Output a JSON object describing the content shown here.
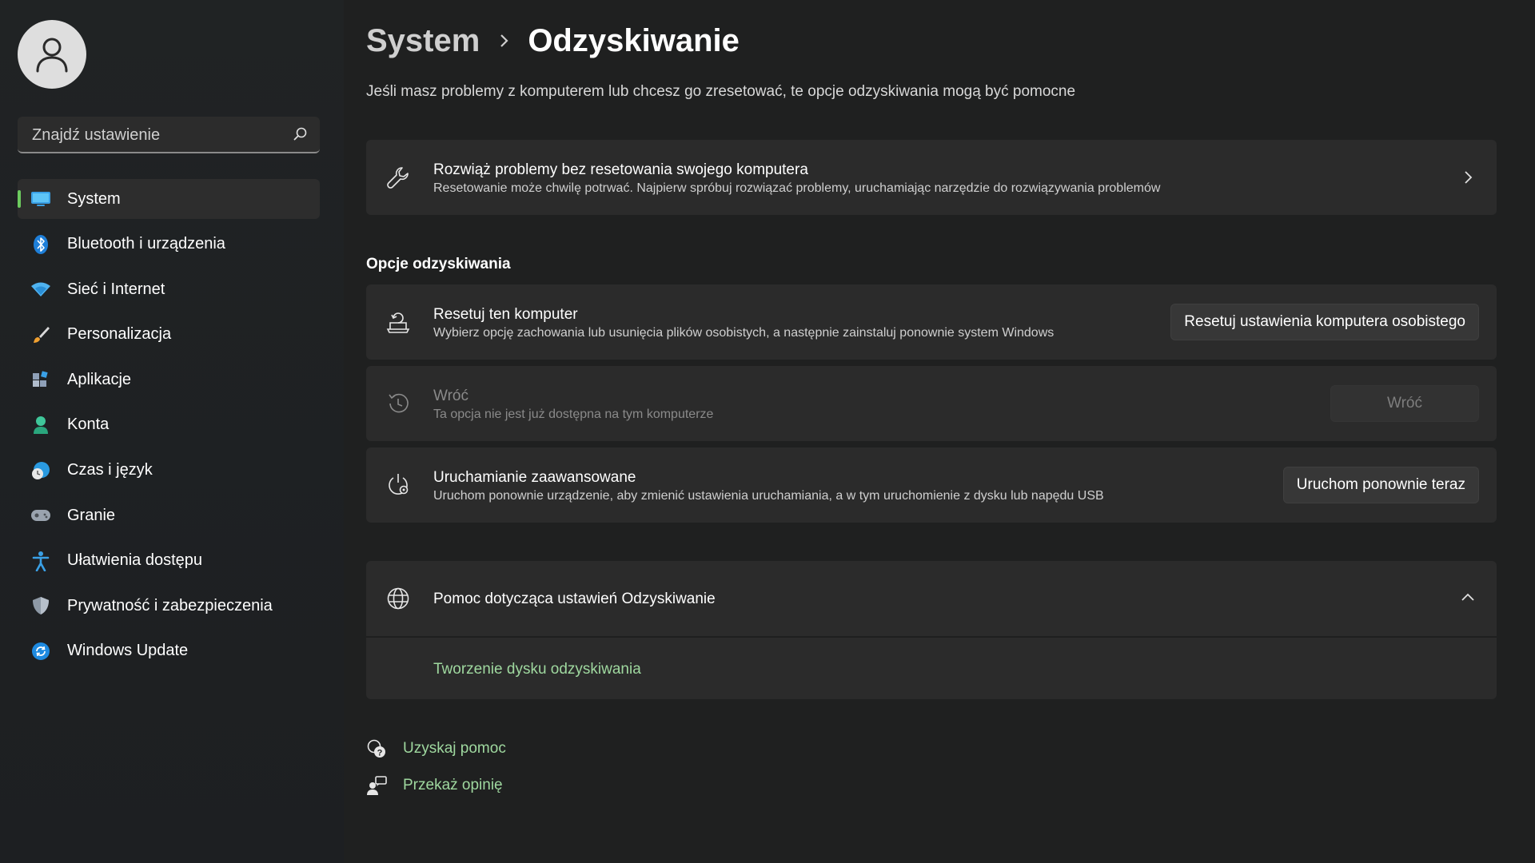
{
  "sidebar": {
    "search_placeholder": "Znajdź ustawienie",
    "items": [
      {
        "label": "System",
        "icon": "monitor-icon",
        "active": true
      },
      {
        "label": "Bluetooth i urządzenia",
        "icon": "bluetooth-icon"
      },
      {
        "label": "Sieć i Internet",
        "icon": "wifi-icon"
      },
      {
        "label": "Personalizacja",
        "icon": "brush-icon"
      },
      {
        "label": "Aplikacje",
        "icon": "apps-icon"
      },
      {
        "label": "Konta",
        "icon": "person-icon"
      },
      {
        "label": "Czas i język",
        "icon": "clock-globe-icon"
      },
      {
        "label": "Granie",
        "icon": "gamepad-icon"
      },
      {
        "label": "Ułatwienia dostępu",
        "icon": "accessibility-icon"
      },
      {
        "label": "Prywatność i zabezpieczenia",
        "icon": "shield-icon"
      },
      {
        "label": "Windows Update",
        "icon": "update-icon"
      }
    ]
  },
  "breadcrumb": {
    "root": "System",
    "current": "Odzyskiwanie"
  },
  "subtitle": "Jeśli masz problemy z komputerem lub chcesz go zresetować, te opcje odzyskiwania mogą być pomocne",
  "troubleshoot": {
    "title": "Rozwiąż problemy bez resetowania swojego komputera",
    "desc": "Resetowanie może chwilę potrwać. Najpierw spróbuj rozwiązać problemy, uruchamiając narzędzie do rozwiązywania problemów"
  },
  "section_title": "Opcje odzyskiwania",
  "options": {
    "reset": {
      "title": "Resetuj ten komputer",
      "desc": "Wybierz opcję zachowania lub usunięcia plików osobistych, a następnie zainstaluj ponownie system Windows",
      "button": "Resetuj ustawienia komputera osobistego"
    },
    "goback": {
      "title": "Wróć",
      "desc": "Ta opcja nie jest już dostępna na tym komputerze",
      "button": "Wróć"
    },
    "advanced": {
      "title": "Uruchamianie zaawansowane",
      "desc": "Uruchom ponownie urządzenie, aby zmienić ustawienia uruchamiania, a w tym uruchomienie z dysku lub napędu USB",
      "button": "Uruchom ponownie teraz"
    }
  },
  "help": {
    "title": "Pomoc dotycząca ustawień Odzyskiwanie",
    "link": "Tworzenie dysku odzyskiwania"
  },
  "footer": {
    "get_help": "Uzyskaj pomoc",
    "feedback": "Przekaż opinię"
  },
  "colors": {
    "accent": "#6ccb5f",
    "link": "#9fd89f",
    "card": "#2b2b2b",
    "background": "#1f2020"
  }
}
